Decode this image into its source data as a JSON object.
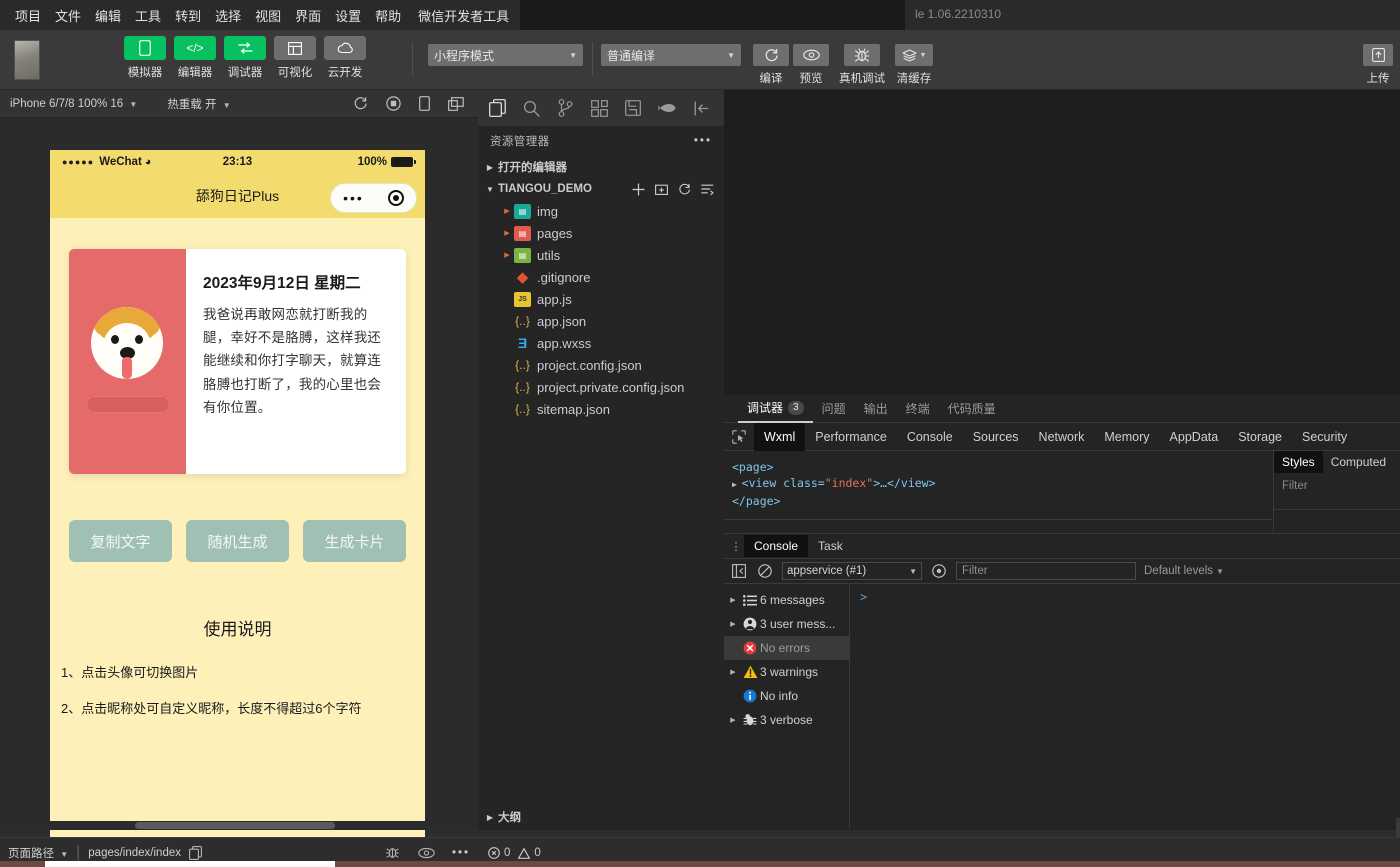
{
  "menubar": {
    "items": [
      "项目",
      "文件",
      "编辑",
      "工具",
      "转到",
      "选择",
      "视图",
      "界面",
      "设置",
      "帮助"
    ],
    "brand": "微信开发者工具",
    "version": "le 1.06.2210310"
  },
  "toolbar": {
    "mode_buttons": [
      {
        "label": "模拟器",
        "icon": "phone-icon",
        "color": "#07c160"
      },
      {
        "label": "编辑器",
        "icon": "code-icon",
        "color": "#07c160"
      },
      {
        "label": "调试器",
        "icon": "debug-icon",
        "color": "#07c160"
      },
      {
        "label": "可视化",
        "icon": "layout-icon",
        "color": "#6e6e6e"
      },
      {
        "label": "云开发",
        "icon": "cloud-icon",
        "color": "#6e6e6e"
      }
    ],
    "mode_select": "小程序模式",
    "compile_select": "普通编译",
    "action_buttons": [
      {
        "label": "编译",
        "icon": "refresh-icon"
      },
      {
        "label": "预览",
        "icon": "eye-icon"
      },
      {
        "label": "真机调试",
        "icon": "bug-icon"
      },
      {
        "label": "清缓存",
        "icon": "layers-icon"
      }
    ],
    "upload_label": "上传",
    "upload_icon": "upload-icon"
  },
  "simulator_bar": {
    "device": "iPhone 6/7/8 100% 16",
    "hot_reload": "热重载 开",
    "icons": [
      "refresh-icon",
      "record-icon",
      "rotate-icon",
      "multiscreen-icon"
    ]
  },
  "phone": {
    "status": {
      "carrier": "WeChat",
      "signal_dots": "●●●●●",
      "wifi_icon": "wifi-icon",
      "time": "23:13",
      "battery_percent": "100%"
    },
    "nav_title": "舔狗日记Plus",
    "capsule": {
      "more_icon": "more-dots-icon",
      "target_icon": "target-icon"
    },
    "card": {
      "date": "2023年9月12日 星期二",
      "text": "我爸说再敢网恋就打断我的腿，幸好不是胳膊，这样我还能继续和你打字聊天，就算连胳膊也打断了，我的心里也会有你位置。",
      "avatar_icon": "shiba-dog-icon",
      "accent_color": "#e56b6b"
    },
    "buttons": [
      "复制文字",
      "随机生成",
      "生成卡片"
    ],
    "help_title": "使用说明",
    "help_lines": [
      "1、点击头像可切换图片",
      "2、点击昵称处可自定义昵称，长度不得超过6个字符"
    ],
    "bg_color": "#fdf0b8",
    "header_color": "#f3dc6d"
  },
  "explorer": {
    "activity_icons": [
      "files-icon",
      "search-icon",
      "source-control-icon",
      "extensions-icon",
      "save-icon",
      "debug-fish-icon",
      "collapse-panel-icon"
    ],
    "title": "资源管理器",
    "more_icon": "ellipsis-icon",
    "open_editors": "打开的编辑器",
    "project_name": "TIANGOU_DEMO",
    "project_actions": [
      "new-file-icon",
      "new-folder-icon",
      "refresh-icon",
      "collapse-all-icon"
    ],
    "tree": [
      {
        "name": "img",
        "type": "folder",
        "icon_color": "#18a999",
        "indent": 1
      },
      {
        "name": "pages",
        "type": "folder",
        "icon_color": "#e05a4f",
        "indent": 1
      },
      {
        "name": "utils",
        "type": "folder",
        "icon_color": "#7cb342",
        "indent": 1
      },
      {
        "name": ".gitignore",
        "type": "git",
        "indent": 1
      },
      {
        "name": "app.js",
        "type": "js",
        "indent": 1
      },
      {
        "name": "app.json",
        "type": "json",
        "indent": 1
      },
      {
        "name": "app.wxss",
        "type": "wxss",
        "indent": 1
      },
      {
        "name": "project.config.json",
        "type": "json",
        "indent": 1
      },
      {
        "name": "project.private.config.json",
        "type": "json",
        "indent": 1
      },
      {
        "name": "sitemap.json",
        "type": "json",
        "indent": 1
      }
    ],
    "outline": "大纲"
  },
  "devtools": {
    "top_tabs": [
      {
        "label": "调试器",
        "badge": "3",
        "active": true
      },
      {
        "label": "问题",
        "active": false
      },
      {
        "label": "输出",
        "active": false
      },
      {
        "label": "终端",
        "active": false
      },
      {
        "label": "代码质量",
        "active": false
      }
    ],
    "picker_icon": "inspect-element-icon",
    "tabs": [
      "Wxml",
      "Performance",
      "Console",
      "Sources",
      "Network",
      "Memory",
      "AppData",
      "Storage",
      "Security"
    ],
    "active_tab": "Wxml",
    "wxml": {
      "line1": "<page>",
      "line2_open": "<view class=",
      "line2_attr": "\"index\"",
      "line2_close": ">…</view>",
      "line3": "</page>"
    },
    "styles_tabs": [
      "Styles",
      "Computed"
    ],
    "styles_active": "Styles",
    "styles_filter_placeholder": "Filter",
    "console": {
      "tabs": [
        "Console",
        "Task"
      ],
      "active_tab": "Console",
      "context": "appservice (#1)",
      "filter_placeholder": "Filter",
      "levels": "Default levels",
      "messages": [
        {
          "label": "6 messages",
          "icon": "list-icon",
          "expandable": true,
          "selected": false
        },
        {
          "label": "3 user mess...",
          "icon": "user-icon",
          "expandable": true,
          "selected": false
        },
        {
          "label": "No errors",
          "icon": "error-icon",
          "expandable": false,
          "selected": true
        },
        {
          "label": "3 warnings",
          "icon": "warning-icon",
          "expandable": true,
          "selected": false
        },
        {
          "label": "No info",
          "icon": "info-icon",
          "expandable": false,
          "selected": false
        },
        {
          "label": "3 verbose",
          "icon": "verbose-icon",
          "expandable": true,
          "selected": false
        }
      ],
      "prompt": ">"
    }
  },
  "statusbar": {
    "page_path_label": "页面路径",
    "page_path_value": "pages/index/index",
    "copy_icon": "copy-icon",
    "icons": [
      "bug-icon",
      "eye-icon",
      "ellipsis-icon"
    ],
    "problems_errors": "0",
    "problems_warnings": "0"
  }
}
